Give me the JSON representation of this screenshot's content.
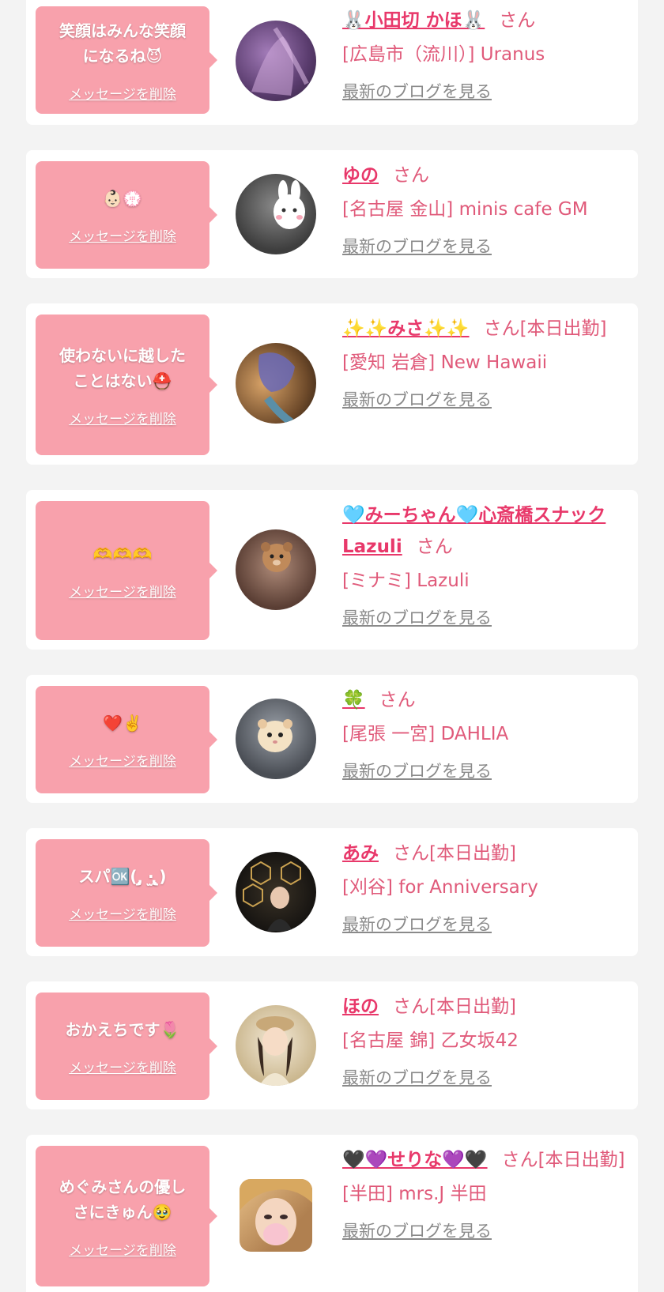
{
  "delete_label": "メッセージを削除",
  "blog_label": "最新のブログを見る",
  "san_label": "さん",
  "cards": [
    {
      "message_lines": [
        "笑顔はみんな笑顔",
        "になるね😈"
      ],
      "name": "🐰小田切 かほ🐰",
      "suffix": "さん",
      "shop": "[広島市（流川）] Uranus"
    },
    {
      "message_lines": [
        "👶🏻💮"
      ],
      "name": "ゆの",
      "suffix": "さん",
      "shop": "[名古屋 金山] minis cafe GM"
    },
    {
      "message_lines": [
        "使わないに越した",
        "ことはない⛑️"
      ],
      "name": "✨✨みさ✨✨",
      "suffix": "さん[本日出勤]",
      "shop": "[愛知 岩倉] New Hawaii"
    },
    {
      "message_lines": [
        "🫶🫶🫶"
      ],
      "name": "🩵みーちゃん🩵心斎橋スナックLazuli",
      "suffix": "さん",
      "shop": "[ミナミ] Lazuli"
    },
    {
      "message_lines": [
        "❤️✌️"
      ],
      "name": "🍀",
      "suffix": "さん",
      "shop": "[尾張 一宮] DAHLIA"
    },
    {
      "message_lines": [
        "スパ🆗( ̨̡ ‧̫ ̧̢)"
      ],
      "name": "あみ",
      "suffix": "さん[本日出勤]",
      "shop": "[刈谷] for Anniversary"
    },
    {
      "message_lines": [
        "おかえちです🌷"
      ],
      "name": "ほの",
      "suffix": "さん[本日出勤]",
      "shop": "[名古屋 錦] 乙女坂42"
    },
    {
      "message_lines": [
        "めぐみさんの優し",
        "さにきゅん🥹"
      ],
      "name": "🖤💜せりな💜🖤",
      "suffix": "さん[本日出勤]",
      "shop": "[半田] mrs.J 半田"
    }
  ]
}
